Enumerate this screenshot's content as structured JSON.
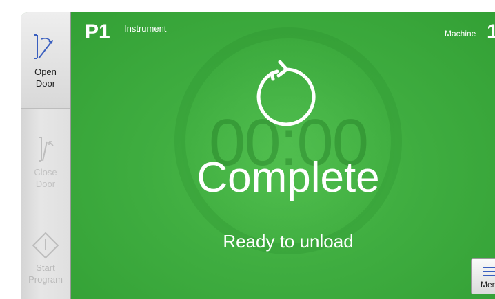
{
  "sidebar": {
    "open_door": {
      "line1": "Open",
      "line2": "Door",
      "icon": "open-door-icon",
      "enabled": true
    },
    "close_door": {
      "line1": "Close",
      "line2": "Door",
      "icon": "close-door-icon",
      "enabled": false
    },
    "start_program": {
      "line1": "Start",
      "line2": "Program",
      "icon": "start-program-icon",
      "enabled": false
    }
  },
  "header": {
    "program": "P1",
    "instrument_label": "Instrument",
    "machine_label": "Machine",
    "machine_number": "1"
  },
  "status": {
    "ghost_timer": "00:00",
    "title": "Complete",
    "subtitle": "Ready to unload",
    "icon": "refresh-icon"
  },
  "menu": {
    "label": "Menu",
    "icon": "hamburger-icon"
  },
  "colors": {
    "status_green": "#3aa63c",
    "sidebar_gray": "#e0e0e0",
    "icon_blue": "#3a5fbf",
    "text_white": "#ffffff"
  }
}
